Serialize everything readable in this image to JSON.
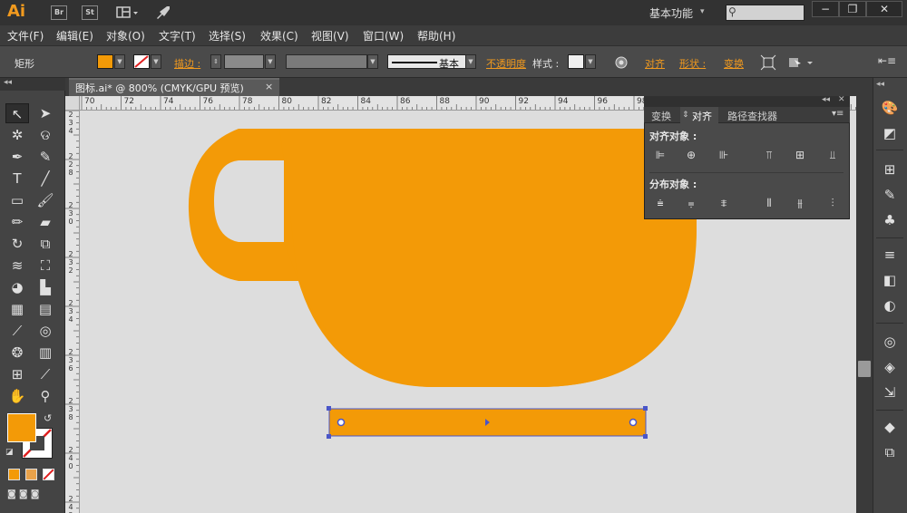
{
  "app": {
    "logo": "Ai",
    "bridge_buttons": [
      "Br",
      "St"
    ],
    "workspace": "基本功能",
    "window_controls": [
      "minimize-icon",
      "restore-icon",
      "close-icon"
    ]
  },
  "menu": [
    "文件(F)",
    "编辑(E)",
    "对象(O)",
    "文字(T)",
    "选择(S)",
    "效果(C)",
    "视图(V)",
    "窗口(W)",
    "帮助(H)"
  ],
  "control_bar": {
    "object_type": "矩形",
    "fill_color": "#f39a07",
    "stroke_label": "描边 :",
    "stroke_style": "基本",
    "opacity_label": "不透明度",
    "style_label": "样式 :",
    "align_label": "对齐",
    "shape_label": "形状 :",
    "transform_label": "变换"
  },
  "document_tab": {
    "title": "图标.ai* @ 800% (CMYK/GPU 预览)",
    "close": "×"
  },
  "ruler": {
    "h_ticks": [
      "70",
      "72",
      "74",
      "76",
      "78",
      "80",
      "82",
      "84",
      "86",
      "88",
      "90",
      "92",
      "94",
      "96",
      "98"
    ],
    "v_ticks": [
      "2 3 4",
      "2 2 8",
      "2 3 0",
      "2 3 2",
      "2 3 4",
      "2 3 6",
      "2 3 8",
      "2 4 0",
      "2 4 2"
    ]
  },
  "align_panel": {
    "tabs": [
      "变换",
      "对齐",
      "路径查找器"
    ],
    "active_tab": "对齐",
    "align_objects_label": "对齐对象 :",
    "distribute_objects_label": "分布对象 :"
  },
  "colors": {
    "accent": "#f29a1e",
    "artwork": "#f39a07",
    "selection": "#4a56c8",
    "canvas": "#dddddd"
  }
}
